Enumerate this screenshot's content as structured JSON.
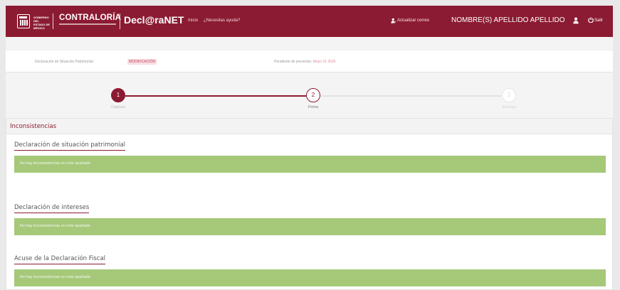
{
  "header": {
    "gob_text": "GOBIERNO DEL ESTADO DE MÉXICO",
    "contraloria": "CONTRALORÍA",
    "brand": "Decl@raNET",
    "nav": [
      "Inicio",
      "¿Necesitas ayuda?"
    ],
    "update_email": "Actualizar correo",
    "user_name": "NOMBRE(S) APELLIDO APELLIDO",
    "logout": "Salir",
    "icons": [
      "building-icon",
      "user-edit-icon",
      "user-icon",
      "power-icon"
    ],
    "colors": {
      "header_bg": "#8b1b32"
    }
  },
  "info": {
    "declaration_type": "Declaración de Situación Patrimonial",
    "modality": "MODIFICACIÓN",
    "pending_label": "Pendiente de presentar:",
    "pending_date": "Mayo 31 2026"
  },
  "stepper": {
    "steps": [
      {
        "number": "1",
        "label": "Captura"
      },
      {
        "number": "2",
        "label": "Firma"
      },
      {
        "number": "3",
        "label": "Entrega"
      }
    ],
    "current_step": 2
  },
  "panel": {
    "title": "Inconsistencias",
    "sections": [
      {
        "title": "Declaración de situación patrimonial",
        "message": "No hay inconsistencias en este apartado"
      },
      {
        "title": "Declaración de intereses",
        "message": "No hay inconsistencias en este apartado"
      },
      {
        "title": "Acuse de la Declaración Fiscal",
        "message": "No hay inconsistencias en este apartado"
      }
    ],
    "colors": {
      "alert_bg": "#a5c979",
      "accent": "#8b1b32"
    }
  }
}
